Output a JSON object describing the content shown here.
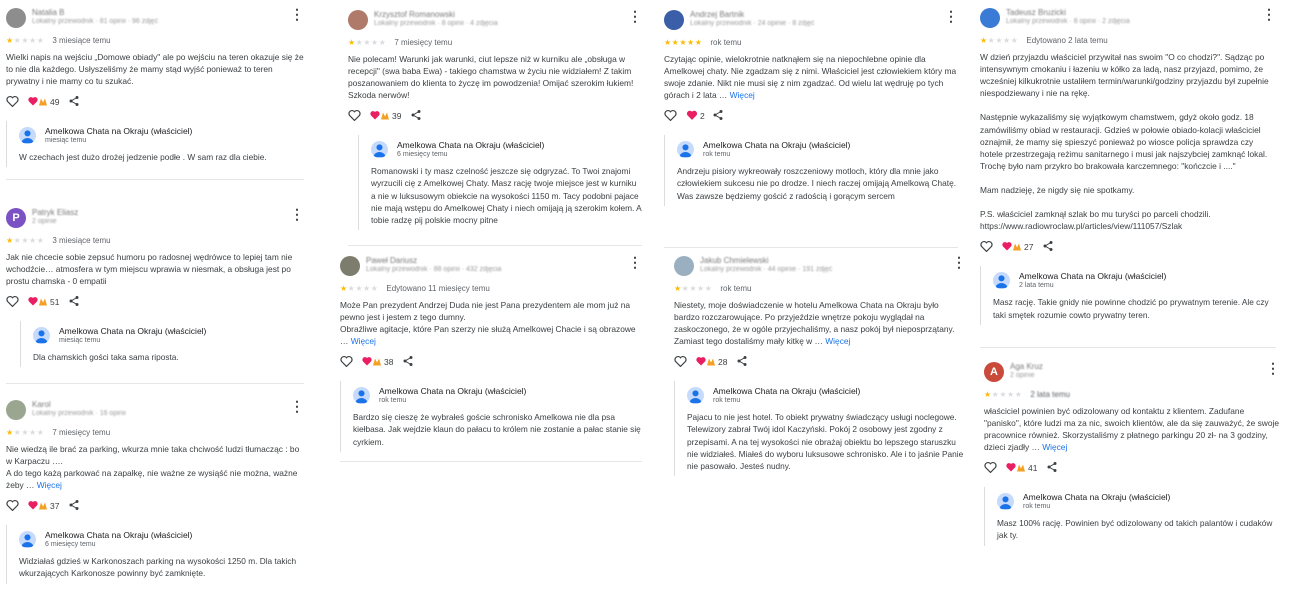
{
  "colors": {
    "star": "#fbbc04",
    "star_empty": "#dadce0",
    "link": "#1a73e8",
    "heart": "#e91e63"
  },
  "icons": {
    "menu": "more-vert-icon",
    "like": "heart-outline-icon",
    "reactions": "heart-and-hands-reactions-icon",
    "share": "share-icon"
  },
  "reviews": [
    {
      "name": "Natalia B",
      "meta": "Lokalny przewodnik · 81 opinii · 96 zdjęć",
      "avatar_color": "#8d8d8d",
      "rating": 1,
      "date": "3 miesiące temu",
      "text": "Wielki napis na wejściu „Domowe obiady\" ale po wejściu na teren okazuje się że to nie dla każdego. Usłyszeliśmy że mamy stąd wyjść ponieważ to teren prywatny i nie mamy co tu szukać.",
      "more": "",
      "likes": "49",
      "reply": {
        "owner": "Amelkowa Chata na Okraju (właściciel)",
        "date": "miesiąc temu",
        "text": "W czechach jest dużo drożej jedzenie podłe . W sam raz dla ciebie."
      }
    },
    {
      "name": "Patryk Eliasz",
      "meta": "2 opinie",
      "avatar_color": "#7b52c4",
      "avatar_letter": "P",
      "rating": 1,
      "date": "3 miesiące temu",
      "text": "Jak nie chcecie sobie zepsuć humoru po radosnej wędrówce to lepiej tam nie wchodźcie… atmosfera w tym miejscu wprawia w niesmak, a obsługa jest po prostu chamska - 0 empatii",
      "more": "",
      "likes": "51",
      "reply": {
        "owner": "Amelkowa Chata na Okraju (właściciel)",
        "date": "miesiąc temu",
        "text": "Dla chamskich gości taka sama riposta."
      }
    },
    {
      "name": "Karol",
      "meta": "Lokalny przewodnik · 16 opinii",
      "avatar_color": "#9aa68f",
      "rating": 1,
      "date": "7 miesięcy temu",
      "text": "Nie wiedzą ile brać za parking, wkurza mnie taka chciwość ludzi tłumacząc : bo w Karpaczu ….\nA do tego każą parkować na zapałkę, nie ważne ze wysiąść nie można, ważne żeby …",
      "more": "Więcej",
      "likes": "37",
      "reply": {
        "owner": "Amelkowa Chata na Okraju (właściciel)",
        "date": "6 miesięcy temu",
        "text": "Widziałaś gdzieś w Karkonoszach parking na wysokości 1250 m. Dla takich wkurzających Karkonosze powinny być zamknięte."
      }
    },
    {
      "name": "Krzysztof Romanowski",
      "meta": "Lokalny przewodnik · 8 opinii · 4 zdjęcia",
      "avatar_color": "#b07a6a",
      "rating": 1,
      "date": "7 miesięcy temu",
      "text": "Nie polecam! Warunki jak warunki, ciut lepsze niż w kurniku ale „obsługa w recepcji\" (swa baba Ewa) - takiego chamstwa w życiu nie widziałem! Z takim poszanowaniem do klienta to życzę im powodzenia! Omijać szerokim łukiem! Szkoda nerwów!",
      "more": "",
      "likes": "39",
      "reply": {
        "owner": "Amelkowa Chata na Okraju (właściciel)",
        "date": "6 miesięcy temu",
        "text": "Romanowski i ty masz czelność jeszcze się odgryzać. To Twoi znajomi wyrzucili cię z Amelkowej Chaty. Masz rację twoje miejsce jest w kurniku a nie w luksusowym obiekcie na wysokości 1150 m. Tacy podobni pajace nie mają wstępu do Amelkowej Chaty i niech omijają ją szerokim kołem. A tobie radzę pij polskie mocny pitne"
      }
    },
    {
      "name": "Paweł Dariusz",
      "meta": "Lokalny przewodnik · 88 opinii · 432 zdjęcia",
      "avatar_color": "#7d7d6e",
      "rating": 1,
      "date": "Edytowano 11 miesięcy temu",
      "text": "Może Pan prezydent Andrzej Duda nie jest Pana prezydentem ale mom już na pewno jest i jestem z tego dumny.\nObraźliwe agitacje, które Pan szerzy nie służą Amelkowej Chacie i są obrazowe …",
      "more": "Więcej",
      "likes": "38",
      "reply": {
        "owner": "Amelkowa Chata na Okraju (właściciel)",
        "date": "rok temu",
        "text": "Bardzo się cieszę że wybrałeś goście schronisko Amelkowa nie dla psa kiełbasa. Jak wejdzie klaun do pałacu to królem nie zostanie a pałac stanie się cyrkiem."
      }
    },
    {
      "name": "Andrzej Bartnik",
      "meta": "Lokalny przewodnik · 24 opinie · 8 zdjęć",
      "avatar_color": "#3b5ea8",
      "rating": 5,
      "date": "rok temu",
      "text": "Czytając opinie, wielokrotnie natknąłem się na niepochlebne opinie dla Amelkowej chaty. Nie zgadzam się z nimi. Właściciel jest człowiekiem który ma swoje zdanie. Nikt nie musi się z nim zgadzać. Od wielu lat wędruję po tych górach i 2 lata …",
      "more": "Więcej",
      "likes": "2",
      "reply": {
        "owner": "Amelkowa Chata na Okraju (właściciel)",
        "date": "rok temu",
        "text": "Andrzeju pisiory wykreowały roszczeniowy motloch, który dla mnie jako człowiekiem sukcesu nie po drodze. I niech raczej omijają Amelkową Chatę. Was zawsze będziemy gościć z radością i gorącym sercem"
      }
    },
    {
      "name": "Jakub Chmielewski",
      "meta": "Lokalny przewodnik · 44 opinie · 191 zdjęć",
      "avatar_color": "#9ab0c0",
      "rating": 1,
      "date": "rok temu",
      "text": "Niestety, moje doświadczenie w hotelu Amelkowa Chata na Okraju było bardzo rozczarowujące. Po przyjeździe wnętrze pokoju wyglądał na zaskoczonego, że w ogóle przyjechaliśmy, a nasz pokój był nieposprzątany. Zamiast tego dostaliśmy mały kitkę w …",
      "more": "Więcej",
      "likes": "28",
      "reply": {
        "owner": "Amelkowa Chata na Okraju (właściciel)",
        "date": "rok temu",
        "text": "Pajacu to nie jest hotel. To obiekt prywatny świadczący usługi noclegowe. Telewizory zabrał Twój idol Kaczyński. Pokój 2 osobowy jest zgodny z przepisami. A na tej wysokości nie obrażaj obiektu bo lepszego staruszku nie widziałeś. Miałeś do wyboru luksusowe schronisko. Ale i to jaśnie Panie nie pasowało. Jesteś nudny."
      }
    },
    {
      "name": "Tadeusz Bruzicki",
      "meta": "Lokalny przewodnik · 8 opinii · 2 zdjęcia",
      "avatar_color": "#3a7bd5",
      "rating": 1,
      "date": "Edytowano 2 lata temu",
      "text": "W dzień przyjazdu właściciel przywitał nas swoim \"O co chodzi?\". Sądząc po intensywnym cmokaniu i łazeniu w kółko za ladą, nasz przyjazd, pomimo, że wcześniej kilkukrotnie ustaliłem termin/warunki/godziny przyjazdu był zupełnie niespodziewany i nie na rękę.\n\nNastępnie wykazaliśmy się wyjątkowym chamstwem, gdyż około godz. 18 zamówiliśmy obiad w restauracji. Gdzieś w połowie obiado-kolacji właściciel oznajmił, że mamy się spieszyć ponieważ po wiosce policja sprawdza czy hotele przestrzegają reżimu sanitarnego i musi jak najszybciej zamknąć lokal. Trochę było nam przykro bo brakowała karczemnego: \"kończcie i ....\"\n\nMam nadzieję, że nigdy się nie spotkamy.\n\nP.S. właściciel zamknął szlak bo mu turyści po parceli chodzili.\nhttps://www.radiowroclaw.pl/articles/view/111057/Szlak",
      "more": "",
      "likes": "27",
      "reply": {
        "owner": "Amelkowa Chata na Okraju (właściciel)",
        "date": "2 lata temu",
        "text": "Masz rację. Takie gnidy nie powinne chodzić po prywatnym terenie. Ale czy taki smętek rozumie cowto prywatny teren."
      }
    },
    {
      "name": "Aga Kruz",
      "meta": "2 opinie",
      "avatar_color": "#c94a3a",
      "avatar_letter": "A",
      "rating": 1,
      "date": "2 lata temu",
      "text": "właściciel powinien być odizolowany od kontaktu z klientem. Zadufane \"panisko\", które ludzi ma za nic, swoich klientów, ale da się zauważyć, że swoje pracownice również. Skorzystaliśmy z płatnego parkingu 20 zł- na 3 godziny, dzieci zjadły …",
      "more": "Więcej",
      "likes": "41",
      "reply": {
        "owner": "Amelkowa Chata na Okraju (właściciel)",
        "date": "rok temu",
        "text": "Masz 100% rację. Powinien być odizolowany od takich palantów i cudaków jak ty."
      }
    }
  ]
}
